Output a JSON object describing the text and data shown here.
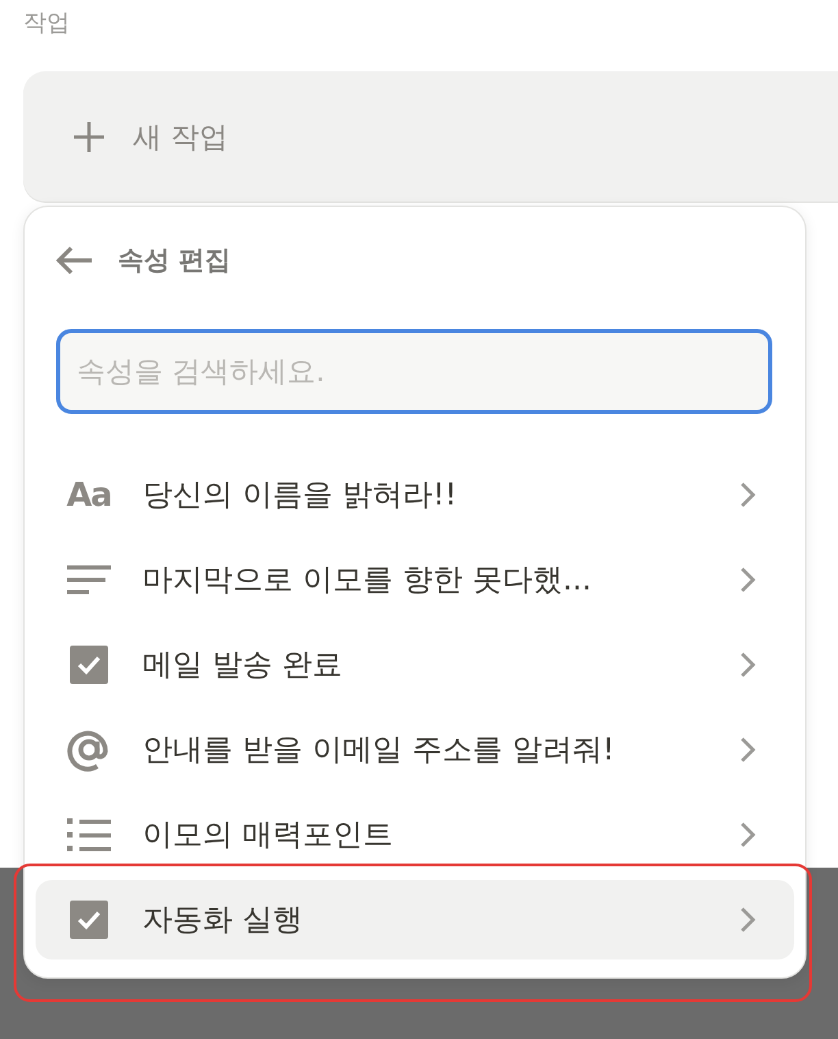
{
  "section_label": "작업",
  "new_task": {
    "label": "새 작업"
  },
  "popup": {
    "title": "속성 편집",
    "search": {
      "placeholder": "속성을 검색하세요."
    },
    "items": [
      {
        "kind": "text",
        "icon_text": "Aa",
        "label": "당신의 이름을 밝혀라!!",
        "selected": false
      },
      {
        "kind": "lines",
        "label": "마지막으로 이모를 향한 못다했...",
        "selected": false
      },
      {
        "kind": "checkbox",
        "label": "메일 발송 완료",
        "selected": false
      },
      {
        "kind": "email",
        "label": "안내를 받을 이메일 주소를 알려줘!",
        "selected": false
      },
      {
        "kind": "list",
        "label": "이모의 매력포인트",
        "selected": false
      },
      {
        "kind": "checkbox",
        "label": "자동화 실행",
        "selected": true
      }
    ]
  },
  "highlight": {
    "on": true
  }
}
